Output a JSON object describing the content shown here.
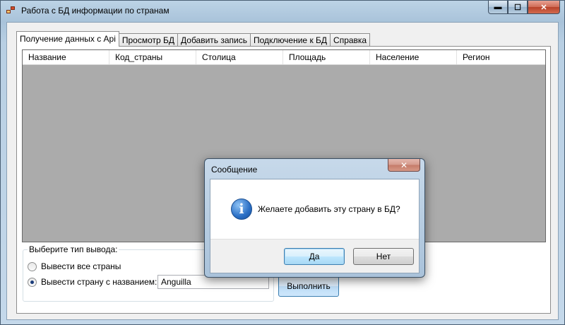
{
  "window": {
    "title": "Работа с БД информации по странам",
    "minimize_glyph": "▬",
    "maximize_glyph": "☐",
    "close_glyph": "✕"
  },
  "tabs": [
    {
      "label": "Получение данных с Api",
      "active": true
    },
    {
      "label": "Просмотр БД",
      "active": false
    },
    {
      "label": "Добавить запись",
      "active": false
    },
    {
      "label": "Подключение к БД",
      "active": false
    },
    {
      "label": "Справка",
      "active": false
    }
  ],
  "grid": {
    "columns": [
      "Название",
      "Код_страны",
      "Столица",
      "Площадь",
      "Население",
      "Регион"
    ]
  },
  "output_group": {
    "legend": "Выберите тип вывода:",
    "option_all": "Вывести все страны",
    "option_by_name": "Вывести страну с названием:",
    "selected": "option_by_name",
    "country_input_value": "Anguilla"
  },
  "execute_button": "Выполнить",
  "dialog": {
    "title": "Сообщение",
    "message": "Желаете добавить эту страну в БД?",
    "yes_label": "Да",
    "no_label": "Нет",
    "icon": "info-icon"
  }
}
